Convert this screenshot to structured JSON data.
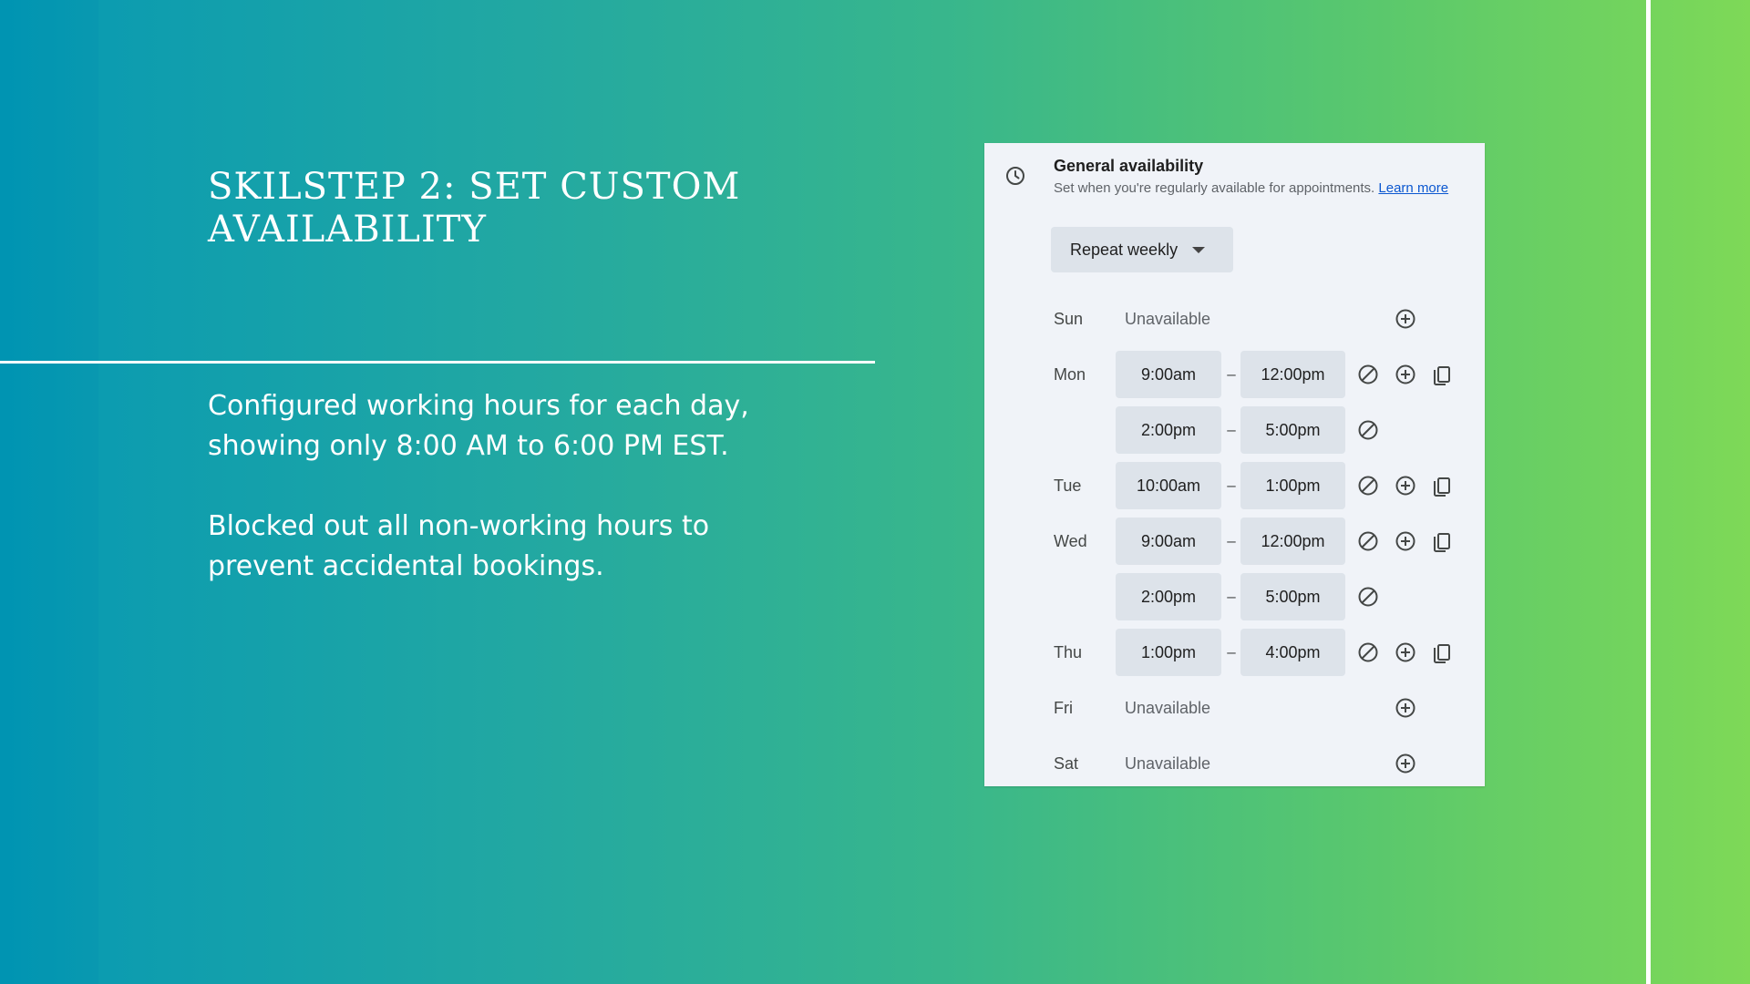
{
  "slide": {
    "title_line1": "SKILSTEP 2: SET CUSTOM",
    "title_line2": "AVAILABILITY",
    "paragraph1": "Configured working hours for each day, showing only 8:00 AM to 6:00 PM EST.",
    "paragraph2": "Blocked out all non-working hours to prevent accidental bookings."
  },
  "panel": {
    "icon": "clock-icon",
    "title": "General availability",
    "subtitle": "Set when you're regularly available for appointments.",
    "learn_more": "Learn more",
    "repeat_label": "Repeat weekly",
    "dash": "–",
    "days": [
      {
        "label": "Sun",
        "status": "Unavailable"
      },
      {
        "label": "Mon",
        "slots": [
          {
            "start": "9:00am",
            "end": "12:00pm"
          },
          {
            "start": "2:00pm",
            "end": "5:00pm"
          }
        ]
      },
      {
        "label": "Tue",
        "slots": [
          {
            "start": "10:00am",
            "end": "1:00pm"
          }
        ]
      },
      {
        "label": "Wed",
        "slots": [
          {
            "start": "9:00am",
            "end": "12:00pm"
          },
          {
            "start": "2:00pm",
            "end": "5:00pm"
          }
        ]
      },
      {
        "label": "Thu",
        "slots": [
          {
            "start": "1:00pm",
            "end": "4:00pm"
          }
        ]
      },
      {
        "label": "Fri",
        "status": "Unavailable"
      },
      {
        "label": "Sat",
        "status": "Unavailable"
      }
    ]
  },
  "colors": {
    "gradient_start": "#0097b2",
    "gradient_end": "#7ed957",
    "panel_background": "#f0f3f8",
    "time_box": "#dde3ea",
    "link": "#0b57d0"
  }
}
